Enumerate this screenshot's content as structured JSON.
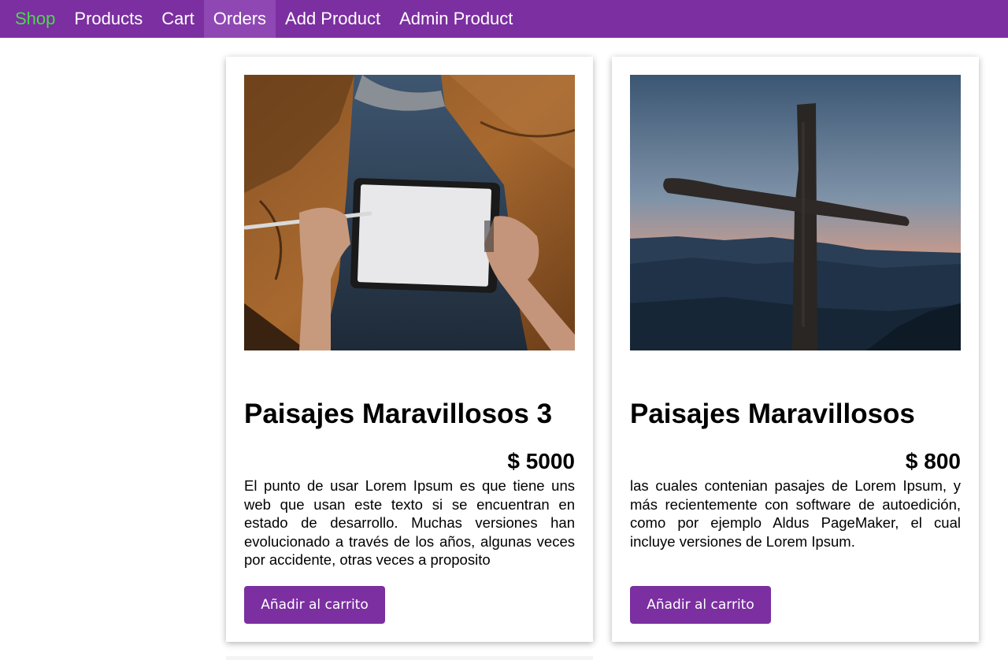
{
  "nav": {
    "brand": "Shop",
    "items": [
      "Products",
      "Cart",
      "Orders",
      "Add Product",
      "Admin Product"
    ],
    "active": "Orders"
  },
  "colors": {
    "nav_bg": "#7b2fa0",
    "brand": "#4cd84c",
    "button_bg": "#7b2fa0"
  },
  "products": [
    {
      "title": "Paisajes Maravillosos 3",
      "price": "$ 5000",
      "description": "El punto de usar Lorem Ipsum es que tiene uns web que usan este texto si se encuentran en estado de desarrollo. Muchas versiones han evolucionado a través de los años, algunas veces por accidente, otras veces a proposito",
      "button": "Añadir al carrito",
      "image": "person-with-tablet-photo"
    },
    {
      "title": "Paisajes Maravillosos",
      "price": "$ 800",
      "description": "las cuales contenian pasajes de Lorem Ipsum, y más recientemente con software de autoedición, como por ejemplo Aldus PageMaker, el cual incluye versiones de Lorem Ipsum.",
      "button": "Añadir al carrito",
      "image": "wooden-cross-sunset-photo"
    }
  ]
}
